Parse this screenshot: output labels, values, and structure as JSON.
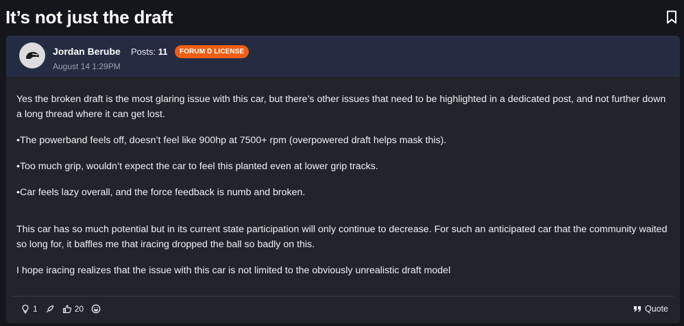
{
  "thread": {
    "title": "It’s not just the draft"
  },
  "post": {
    "author": "Jordan Berube",
    "posts_label": "Posts:",
    "posts_count": "11",
    "badge": "FORUM D LICENSE",
    "date": "August 14 1:29PM",
    "paragraphs": [
      "Yes the broken draft is the most glaring issue with this car, but there’s other issues that need to be highlighted in a dedicated post, and not further down a long thread where it can get lost.",
      "•The powerband feels off, doesn’t feel like 900hp at 7500+ rpm (overpowered draft helps mask this).",
      "•Too much grip, wouldn’t expect the car to feel this planted even at lower grip tracks.",
      "•Car feels lazy overall, and the force feedback is numb and broken.",
      "This car has so much potential but in its current state participation will only continue to decrease. For such an anticipated car that the community waited so long for, it baffles me that iracing dropped the ball so badly on this.",
      "I hope iracing realizes that the issue with this car is not limited to the obviously unrealistic draft model"
    ]
  },
  "footer": {
    "lightbulb_count": "1",
    "like_count": "20",
    "quote_label": "Quote"
  },
  "icons": {
    "bookmark": "bookmark-icon",
    "avatar": "helmet-avatar-icon",
    "lightbulb": "lightbulb-icon",
    "rocket": "rocket-icon",
    "thumbs_up": "thumbs-up-icon",
    "laugh": "laugh-icon",
    "quote": "quote-icon"
  },
  "colors": {
    "background": "#15161c",
    "card": "#23242b",
    "header": "#252c42",
    "badge": "#ee5e14"
  }
}
